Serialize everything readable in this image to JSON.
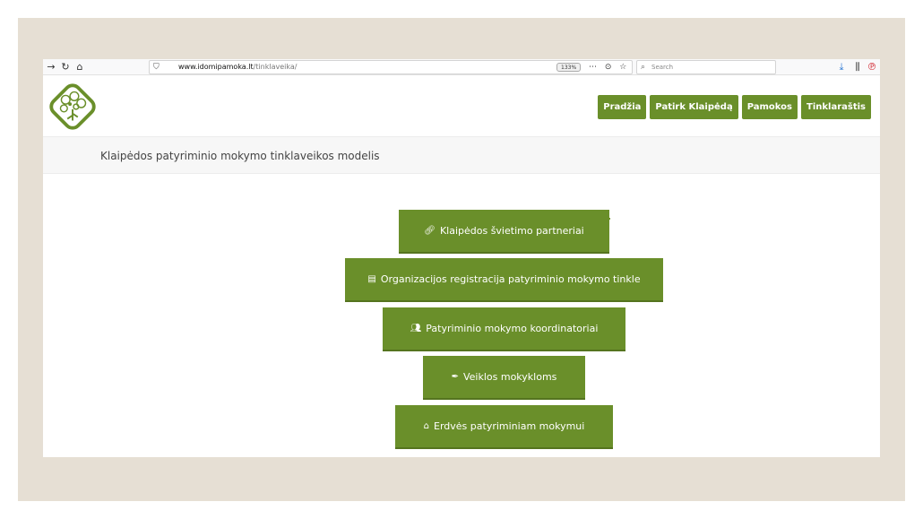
{
  "browser": {
    "url_host": "www.idomipamoka.lt",
    "url_path": "/tinklaveika/",
    "zoom": "133%",
    "search_placeholder": "Search",
    "icons": {
      "back": "arrow-right-icon",
      "reload": "reload-icon",
      "home": "home-icon",
      "shield": "shield-icon",
      "more": "ellipsis-icon",
      "pocket": "pocket-icon",
      "bookmark": "star-icon",
      "search": "search-icon",
      "download": "download-icon",
      "library": "library-icon",
      "pinterest": "pinterest-icon"
    }
  },
  "nav": {
    "items": [
      {
        "label": "Pradžia"
      },
      {
        "label": "Patirk Klaipėdą"
      },
      {
        "label": "Pamokos"
      },
      {
        "label": "Tinklaraštis"
      }
    ]
  },
  "page": {
    "title": "Klaipėdos patyriminio mokymo tinklaveikos modelis"
  },
  "menu": {
    "items": [
      {
        "label": "Klaipėdos švietimo partneriai",
        "icon": "link-icon"
      },
      {
        "label": "Organizacijos registracija patyriminio mokymo tinkle",
        "icon": "document-icon"
      },
      {
        "label": "Patyriminio mokymo koordinatoriai",
        "icon": "users-icon"
      },
      {
        "label": "Veiklos mokykloms",
        "icon": "feather-icon"
      },
      {
        "label": "Erdvės patyriminiam mokymui",
        "icon": "home-icon"
      }
    ]
  },
  "colors": {
    "brand_green": "#6a8f2a",
    "backdrop": "#e6dfd4"
  }
}
